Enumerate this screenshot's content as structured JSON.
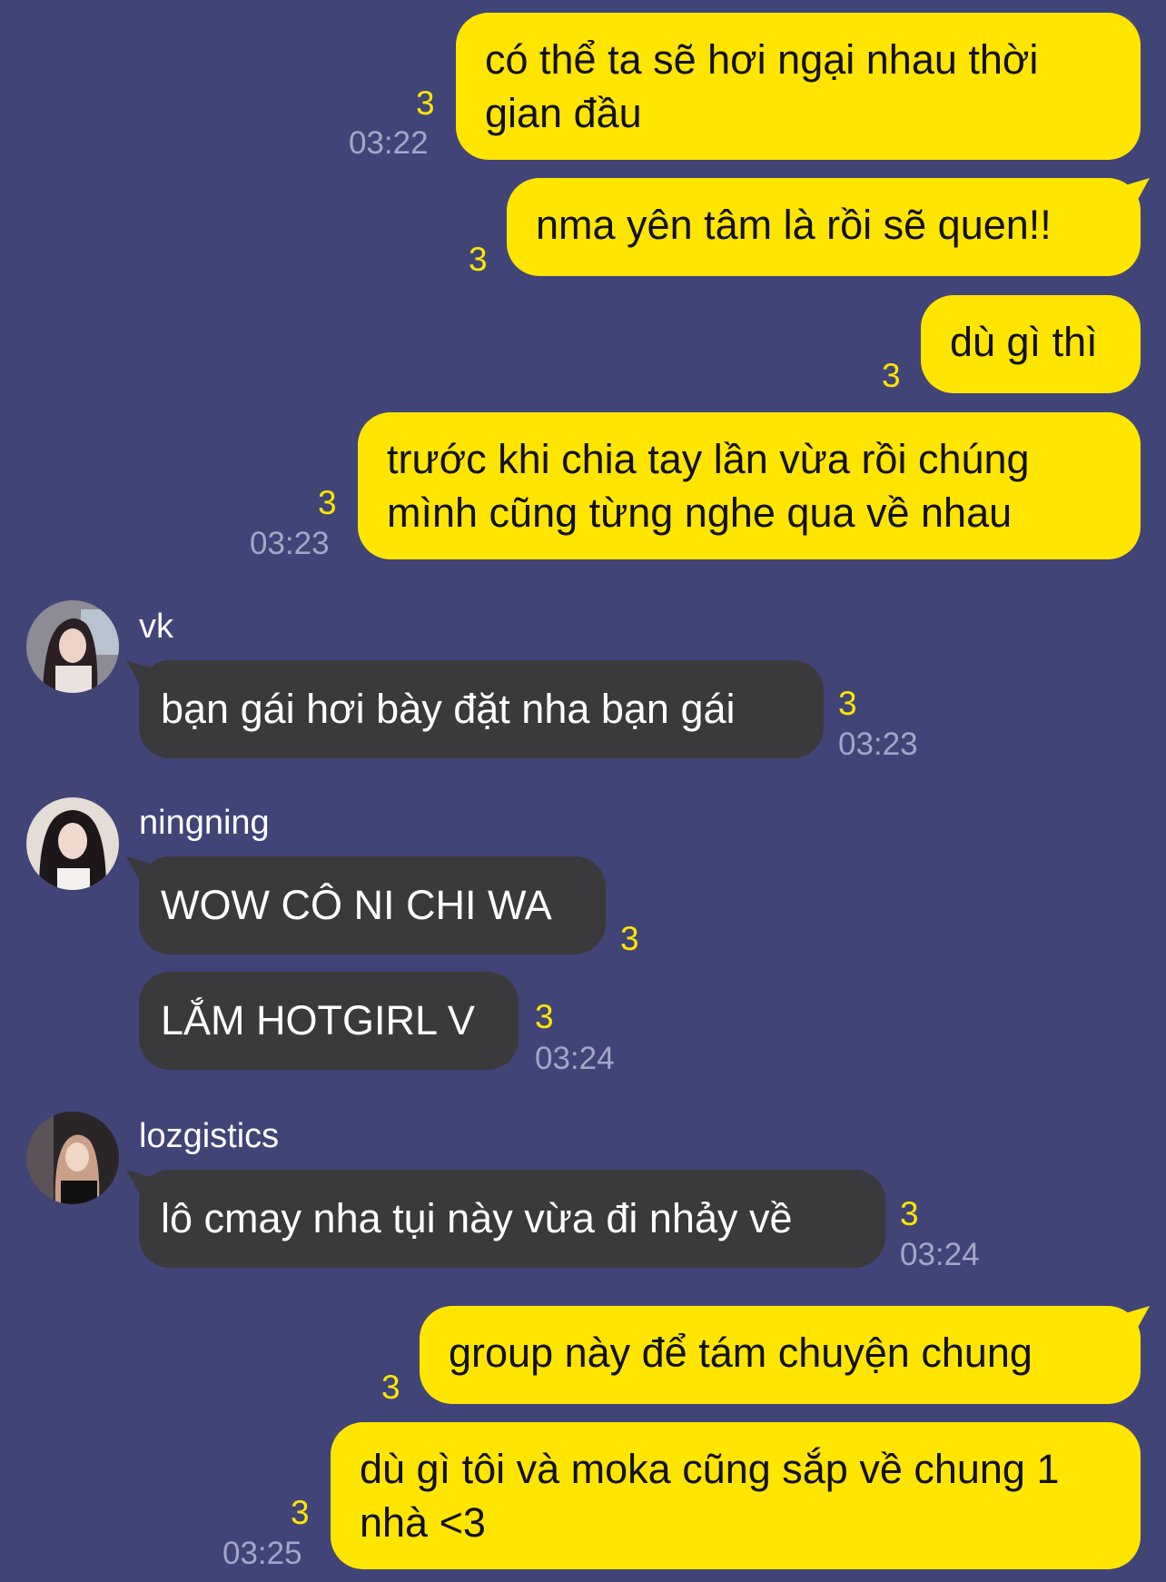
{
  "messages_out": [
    {
      "text": "có thể ta sẽ hơi ngại nhau thời gian đầu",
      "read": "3",
      "time": "03:22"
    },
    {
      "text": "nma yên tâm là rồi sẽ quen!!",
      "read": "3"
    },
    {
      "text": "dù gì thì",
      "read": "3"
    },
    {
      "text": "trước khi chia tay lần vừa rồi chúng mình cũng từng nghe qua về nhau",
      "read": "3",
      "time": "03:23"
    },
    {
      "text": "group này để tám chuyện chung",
      "read": "3"
    },
    {
      "text": "dù gì tôi và moka cũng sắp về chung 1 nhà <3",
      "read": "3",
      "time": "03:25"
    }
  ],
  "vk": {
    "name": "vk",
    "messages": [
      {
        "text": "bạn gái hơi bày đặt nha bạn gái",
        "read": "3",
        "time": "03:23"
      }
    ]
  },
  "ningning": {
    "name": "ningning",
    "messages": [
      {
        "text": "WOW CÔ NI CHI WA",
        "read": "3"
      },
      {
        "text": "LẮM HOTGIRL V",
        "read": "3",
        "time": "03:24"
      }
    ]
  },
  "lozgistics": {
    "name": "lozgistics",
    "messages": [
      {
        "text": "lô cmay nha tụi này vừa đi nhảy về",
        "read": "3",
        "time": "03:24"
      }
    ]
  },
  "colors": {
    "background": "#414477",
    "outgoing_bubble": "#FFE500",
    "incoming_bubble": "#3A3A3C",
    "read_count": "#FFE500",
    "timestamp": "#A3A6C6"
  }
}
